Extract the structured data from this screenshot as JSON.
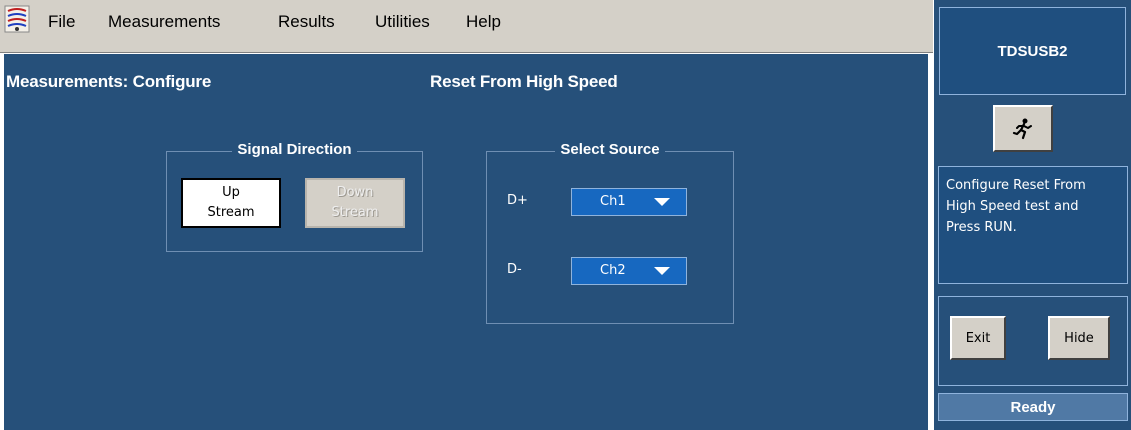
{
  "menu": {
    "items": [
      "File",
      "Measurements",
      "Results",
      "Utilities",
      "Help"
    ]
  },
  "header": {
    "section_title": "Measurements: Configure",
    "test_title": "Reset From High Speed"
  },
  "signal_direction": {
    "title": "Signal Direction",
    "up": {
      "line1": "Up",
      "line2": "Stream",
      "selected": true
    },
    "down": {
      "line1": "Down",
      "line2": "Stream",
      "selected": false,
      "enabled": false
    }
  },
  "select_source": {
    "title": "Select Source",
    "dplus": {
      "label": "D+",
      "value": "Ch1"
    },
    "dminus": {
      "label": "D-",
      "value": "Ch2"
    }
  },
  "side_panel": {
    "app_name": "TDSUSB2",
    "run_icon": "running-man-icon",
    "message_lines": [
      "Configure Reset From",
      "High Speed test and",
      "Press RUN."
    ],
    "exit_label": "Exit",
    "hide_label": "Hide",
    "status": "Ready"
  },
  "colors": {
    "panel": "#26507a",
    "menubar": "#d4d0c8",
    "dropdown": "#1768c0"
  }
}
